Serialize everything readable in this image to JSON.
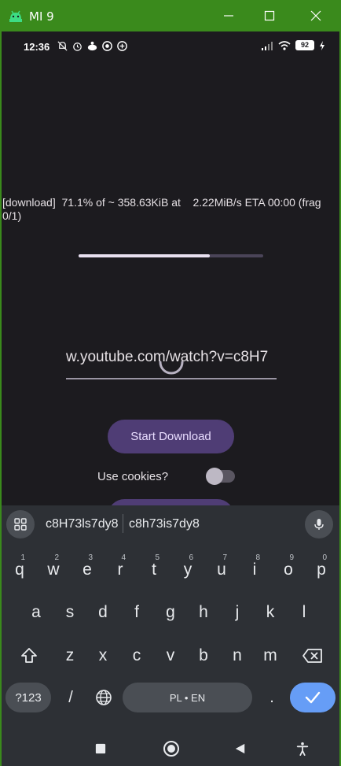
{
  "window": {
    "title": "MI 9"
  },
  "status_bar": {
    "time": "12:36",
    "battery": "92"
  },
  "download": {
    "log": "[download]  71.1% of ~ 358.63KiB at    2.22MiB/s ETA 00:00 (frag 0/1)",
    "progress_fraction": 0.71
  },
  "url_input": {
    "value": "w.youtube.com/watch?v=c8H7"
  },
  "start_button": {
    "label": "Start Download"
  },
  "cookies": {
    "label": "Use cookies?",
    "enabled": false
  },
  "keyboard": {
    "suggestions": [
      "c8H73ls7dy8",
      "c8h73is7dy8"
    ],
    "row1": [
      {
        "key": "q",
        "hint": "1"
      },
      {
        "key": "w",
        "hint": "2"
      },
      {
        "key": "e",
        "hint": "3"
      },
      {
        "key": "r",
        "hint": "4"
      },
      {
        "key": "t",
        "hint": "5"
      },
      {
        "key": "y",
        "hint": "6"
      },
      {
        "key": "u",
        "hint": "7"
      },
      {
        "key": "i",
        "hint": "8"
      },
      {
        "key": "o",
        "hint": "9"
      },
      {
        "key": "p",
        "hint": "0"
      }
    ],
    "row2": [
      "a",
      "s",
      "d",
      "f",
      "g",
      "h",
      "j",
      "k",
      "l"
    ],
    "row3": [
      "z",
      "x",
      "c",
      "v",
      "b",
      "n",
      "m"
    ],
    "symbols_label": "?123",
    "slash_label": "/",
    "space_label": "PL • EN",
    "period_label": "."
  },
  "colors": {
    "titlebar": "#3a8a1c",
    "background": "#1c1b1f",
    "button": "#4f3d75",
    "keyboard": "#2d3035",
    "enter_key": "#669df6"
  }
}
